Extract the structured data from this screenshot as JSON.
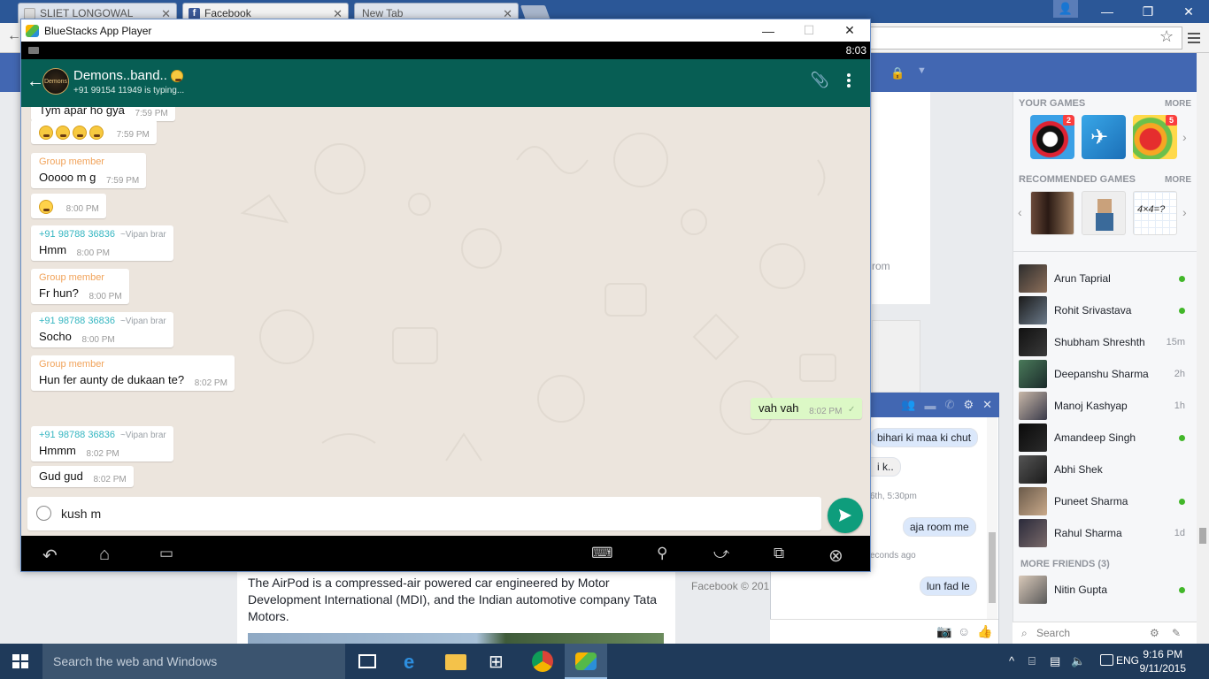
{
  "browser": {
    "tabs": [
      {
        "label": "SLIET LONGOWAL"
      },
      {
        "label": "Facebook"
      },
      {
        "label": "New Tab"
      }
    ]
  },
  "facebook": {
    "games_title": "YOUR GAMES",
    "games_more": "MORE",
    "game_badges": [
      "2",
      "5"
    ],
    "recommended_title": "RECOMMENDED GAMES",
    "recommended_more": "MORE",
    "recommended_game_text": "4×4=?",
    "contacts": [
      {
        "name": "Arun Taprial",
        "status": "online"
      },
      {
        "name": "Rohit Srivastava",
        "status": "online"
      },
      {
        "name": "Shubham Shreshth",
        "status": "15m"
      },
      {
        "name": "Deepanshu Sharma",
        "status": "2h"
      },
      {
        "name": "Manoj Kashyap",
        "status": "1h"
      },
      {
        "name": "Amandeep Singh",
        "status": "online"
      },
      {
        "name": "Abhi Shek",
        "status": ""
      },
      {
        "name": "Puneet Sharma",
        "status": "online"
      },
      {
        "name": "Rahul Sharma",
        "status": "1d"
      }
    ],
    "more_friends": "MORE FRIENDS (3)",
    "more_friends_list": [
      {
        "name": "Nitin Gupta",
        "status": "online"
      }
    ],
    "search_placeholder": "Search",
    "mid_text": "rom",
    "article_text": "The AirPod is a compressed-air powered car engineered by Motor Development International (MDI), and the Indian automotive company Tata Motors.",
    "footer": "Facebook © 201",
    "chat": {
      "messages": [
        {
          "text": "bihari ki maa ki chut",
          "mine": true
        },
        {
          "text": "i k..",
          "mine": false
        },
        {
          "time": "6th, 5:30pm"
        },
        {
          "text": "aja room me",
          "mine": true
        },
        {
          "time": "econds ago"
        },
        {
          "text": "lun fad le",
          "mine": true
        }
      ]
    }
  },
  "bluestacks": {
    "title": "BlueStacks App Player",
    "clock": "8:03",
    "whatsapp": {
      "group_name": "Demons..band..",
      "subtitle": "+91 99154 11949 is typing...",
      "avatar_text": "Demons",
      "input_value": "kush m",
      "messages": [
        {
          "sender": "",
          "text": "Tym apar ho gya",
          "time": "7:59 PM"
        },
        {
          "sender": "",
          "text": "",
          "emoji_count": 4,
          "time": "7:59 PM"
        },
        {
          "sender": "Group member",
          "text": "Ooooo m g",
          "time": "7:59 PM"
        },
        {
          "sender": "",
          "text": "",
          "emoji_count": 1,
          "time": "8:00 PM"
        },
        {
          "sender": "+91 98788 36836",
          "nick": "~Vipan brar",
          "text": "Hmm",
          "time": "8:00 PM"
        },
        {
          "sender": "Group member",
          "text": "Fr hun?",
          "time": "8:00 PM"
        },
        {
          "sender": "+91 98788 36836",
          "nick": "~Vipan brar",
          "text": "Socho",
          "time": "8:00 PM"
        },
        {
          "sender": "Group member",
          "text": "Hun fer aunty de dukaan te?",
          "time": "8:02 PM"
        },
        {
          "sender": "me",
          "text": "vah vah",
          "time": "8:02 PM"
        },
        {
          "sender": "+91 98788 36836",
          "nick": "~Vipan brar",
          "text": "Hmmm",
          "time": "8:02 PM"
        },
        {
          "sender": "",
          "text": "Gud gud",
          "time": "8:02 PM"
        }
      ]
    }
  },
  "taskbar": {
    "search_placeholder": "Search the web and Windows",
    "language": "ENG",
    "time": "9:16 PM",
    "date": "9/11/2015"
  },
  "colors": {
    "whatsapp_header": "#075e54",
    "whatsapp_send": "#0e9d7c",
    "facebook_blue": "#4267b2",
    "taskbar": "#1f3a5a"
  }
}
